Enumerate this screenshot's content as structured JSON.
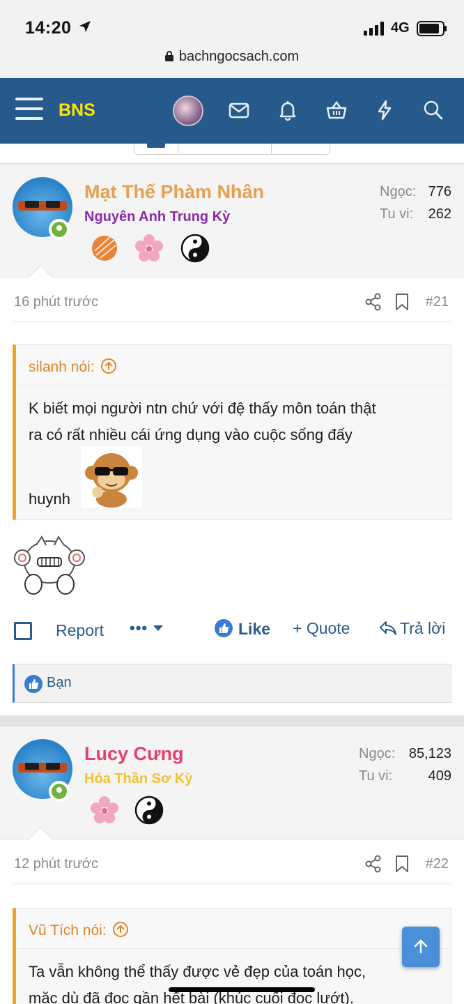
{
  "status_bar": {
    "time": "14:20",
    "network": "4G",
    "url": "bachngocsach.com"
  },
  "navbar": {
    "brand": "BNS"
  },
  "posts": [
    {
      "user_name": "Mạt Thế Phàm Nhân",
      "user_name_color": "#e8a050",
      "rank": "Nguyên Anh Trung Kỳ",
      "rank_color": "#8a2ba8",
      "stat1_label": "Ngọc:",
      "stat1_value": "776",
      "stat2_label": "Tu vi:",
      "stat2_value": "262",
      "time": "16 phút trước",
      "number": "#21",
      "quote_author": "silanh nói:",
      "quote_line1": "K biết mọi người ntn chứ với đệ thấy môn toán thật",
      "quote_line2": "ra có rất nhiều cái ứng dụng vào cuộc sống đấy",
      "quote_line3": "huynh",
      "liked_by": "Bạn"
    },
    {
      "user_name": "Lucy Cưng",
      "user_name_color": "#e0426e",
      "rank": "Hóa Thần Sơ Kỳ",
      "rank_color": "#f2c230",
      "stat1_label": "Ngọc:",
      "stat1_value": "85,123",
      "stat2_label": "Tu vi:",
      "stat2_value": "409",
      "time": "12 phút trước",
      "number": "#22",
      "quote_author": "Vũ Tích nói:",
      "quote_line1": "Ta vẫn không thể thấy được vẻ đẹp của toán học,",
      "quote_line2": "mặc dù đã đọc gần hết bài (khúc cuối đọc lướt)."
    }
  ],
  "actions": {
    "report": "Report",
    "more": "•••",
    "like": "Like",
    "quote": "+ Quote",
    "reply": "Trả lời"
  }
}
